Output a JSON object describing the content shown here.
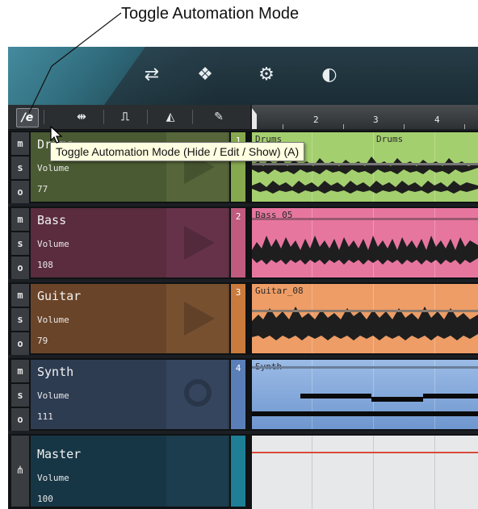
{
  "callout": {
    "label": "Toggle Automation Mode"
  },
  "topbar": {
    "icons": [
      "mixer-icon",
      "cube-icon",
      "gear-icon",
      "speed-icon"
    ]
  },
  "toolbar": {
    "tools": [
      {
        "name": "automation-mode-tool",
        "glyph": "/e"
      },
      {
        "name": "split-tool",
        "glyph": "⇹"
      },
      {
        "name": "step-tool",
        "glyph": "⎍"
      },
      {
        "name": "metronome-tool",
        "glyph": "◭"
      },
      {
        "name": "pencil-tool",
        "glyph": "✎"
      }
    ]
  },
  "ruler": {
    "bars": [
      "2",
      "3",
      "4"
    ]
  },
  "tooltip": {
    "text": "Toggle Automation Mode (Hide / Edit / Show) (A)"
  },
  "msr_labels": {
    "mute": "m",
    "solo": "s",
    "record": "o"
  },
  "tracks": [
    {
      "name": "Drums",
      "number": "1",
      "param": "Volume",
      "value": "77",
      "clip": "Drums",
      "clip2": "Drums",
      "color": "#a4cf6e",
      "panel": "#4a5a32",
      "num_color": "#86a84e"
    },
    {
      "name": "Bass",
      "number": "2",
      "param": "Volume",
      "value": "108",
      "clip": "Bass_05",
      "color": "#e7769f",
      "panel": "#5a2c3e",
      "num_color": "#c05a7e"
    },
    {
      "name": "Guitar",
      "number": "3",
      "param": "Volume",
      "value": "79",
      "clip": "Guitar_08",
      "color": "#ee9d66",
      "panel": "#6a4428",
      "num_color": "#c97a3d"
    },
    {
      "name": "Synth",
      "number": "4",
      "param": "Volume",
      "value": "111",
      "clip": "Synth",
      "color": "#7fa6d9",
      "panel": "#2e3c52",
      "num_color": "#5a7fb8"
    }
  ],
  "master": {
    "name": "Master",
    "param": "Volume",
    "value": "100"
  }
}
